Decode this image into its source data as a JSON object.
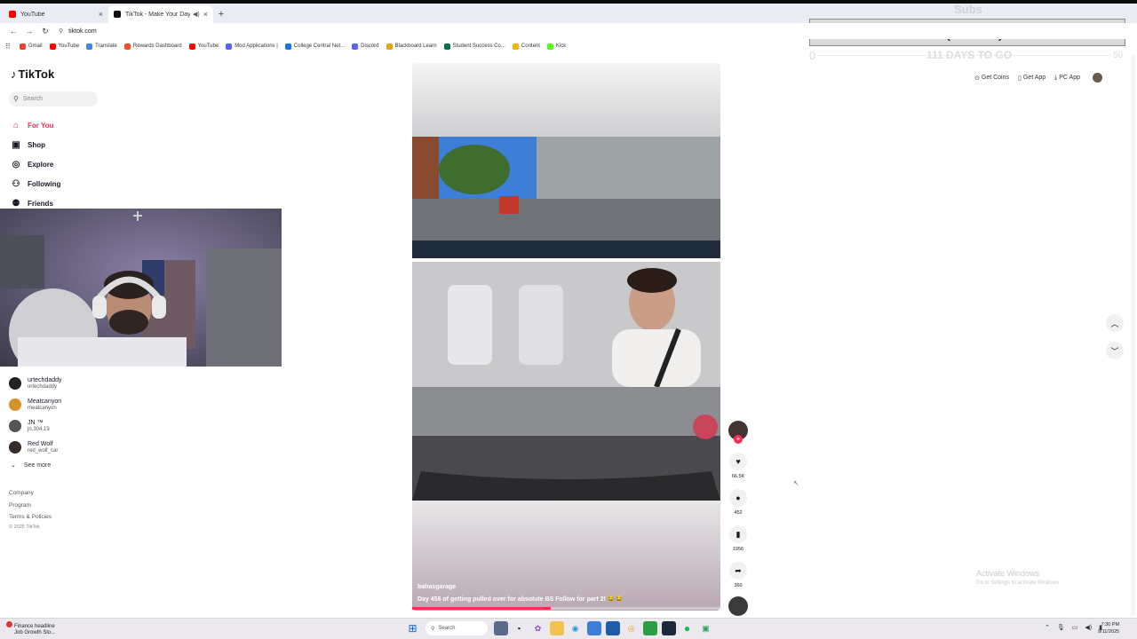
{
  "browser": {
    "tabs": [
      {
        "label": "YouTube",
        "active": false,
        "color": "#ff0000"
      },
      {
        "label": "TikTok - Make Your Day",
        "active": true,
        "color": "#111111"
      }
    ],
    "url": "tiktok.com",
    "bookmarks": [
      {
        "label": "Gmail",
        "color": "#ea4335"
      },
      {
        "label": "YouTube",
        "color": "#ff0000"
      },
      {
        "label": "Translate",
        "color": "#4285f4"
      },
      {
        "label": "Rewards Dashboard",
        "color": "#f25022"
      },
      {
        "label": "YouTube",
        "color": "#ff0000"
      },
      {
        "label": "Mod Applications |",
        "color": "#5865f2"
      },
      {
        "label": "College Central Net...",
        "color": "#1a73e8"
      },
      {
        "label": "Discord",
        "color": "#5865f2"
      },
      {
        "label": "Blackboard Learn",
        "color": "#e8a317"
      },
      {
        "label": "Student Success Co...",
        "color": "#0b6e4f"
      },
      {
        "label": "Content",
        "color": "#f4b400"
      },
      {
        "label": "Kick",
        "color": "#53fc18"
      }
    ]
  },
  "subs_overlay": {
    "title": "Subs",
    "value": "0 (0.00%)",
    "start": "0",
    "days": "111 DAYS TO GO",
    "end": "50"
  },
  "tiktok": {
    "logo": "TikTok",
    "search_placeholder": "Search",
    "menu": [
      {
        "label": "For You",
        "icon": "home-icon",
        "glyph": "⌂",
        "active": true
      },
      {
        "label": "Shop",
        "icon": "shop-icon",
        "glyph": "🛍",
        "active": false
      },
      {
        "label": "Explore",
        "icon": "explore-icon",
        "glyph": "◎",
        "active": false
      },
      {
        "label": "Following",
        "icon": "following-icon",
        "glyph": "⚇",
        "active": false
      },
      {
        "label": "Friends",
        "icon": "friends-icon",
        "glyph": "⚉",
        "active": false
      }
    ],
    "accounts": [
      {
        "name": "urtechdaddy",
        "username": "urtechdaddy"
      },
      {
        "name": "Meatcanyon",
        "username": "meatcanyon"
      },
      {
        "name": "JN ™",
        "username": "jn.304.19"
      },
      {
        "name": "Red Wolf",
        "username": "red_wolf_car"
      }
    ],
    "see_more": "See more",
    "footer": [
      "Company",
      "Program",
      "Terms & Policies"
    ],
    "copyright": "© 2025 TikTok",
    "top_links": {
      "coins": "Get Coins",
      "app": "Get App",
      "pc": "PC App"
    },
    "video": {
      "username": "bahasgarage",
      "caption": "Day 456 of getting pulled over for absolute BS Follow for part 2! 😂😂",
      "progress": 0.45
    },
    "actions": {
      "likes": "66.5K",
      "comments": "452",
      "saves": "1956",
      "shares": "360"
    }
  },
  "watermark": {
    "line1": "Activate Windows",
    "line2": "Go to Settings to activate Windows."
  },
  "taskbar": {
    "news_title": "Finance headline",
    "news_sub": "Job Growth Slo...",
    "search": "Search",
    "time": "7:30 PM",
    "date": "9/11/2025"
  }
}
